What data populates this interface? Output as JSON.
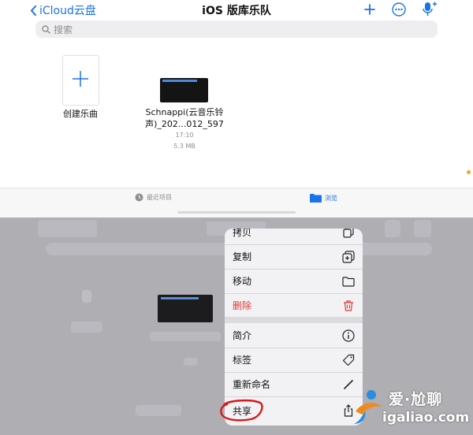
{
  "header": {
    "back_label": "iCloud云盘",
    "title": "iOS 版库乐队"
  },
  "search": {
    "placeholder": "搜索"
  },
  "create": {
    "label": "创建乐曲"
  },
  "file": {
    "name_line1": "Schnappi(云音乐铃",
    "name_line2": "声)_202...012_597",
    "time": "17:10",
    "size": "5.3 MB"
  },
  "tabs": [
    {
      "label": "最近项目",
      "active": false
    },
    {
      "label": "浏览",
      "active": true
    }
  ],
  "context_menu": {
    "items": [
      {
        "label": "拷贝",
        "icon": "copy-doc-icon"
      },
      {
        "label": "复制",
        "icon": "duplicate-icon"
      },
      {
        "label": "移动",
        "icon": "folder-icon"
      },
      {
        "label": "删除",
        "icon": "trash-icon",
        "destructive": true
      },
      {
        "label": "简介",
        "icon": "info-icon"
      },
      {
        "label": "标签",
        "icon": "tag-icon"
      },
      {
        "label": "重新命名",
        "icon": "pencil-icon"
      },
      {
        "label": "共享",
        "icon": "share-icon"
      }
    ]
  },
  "watermark": {
    "line1": "爱·尬聊",
    "line2": "igaliao.com"
  },
  "colors": {
    "accent": "#1a73e8",
    "destructive": "#e03a3a",
    "annotation": "#d8181b"
  }
}
